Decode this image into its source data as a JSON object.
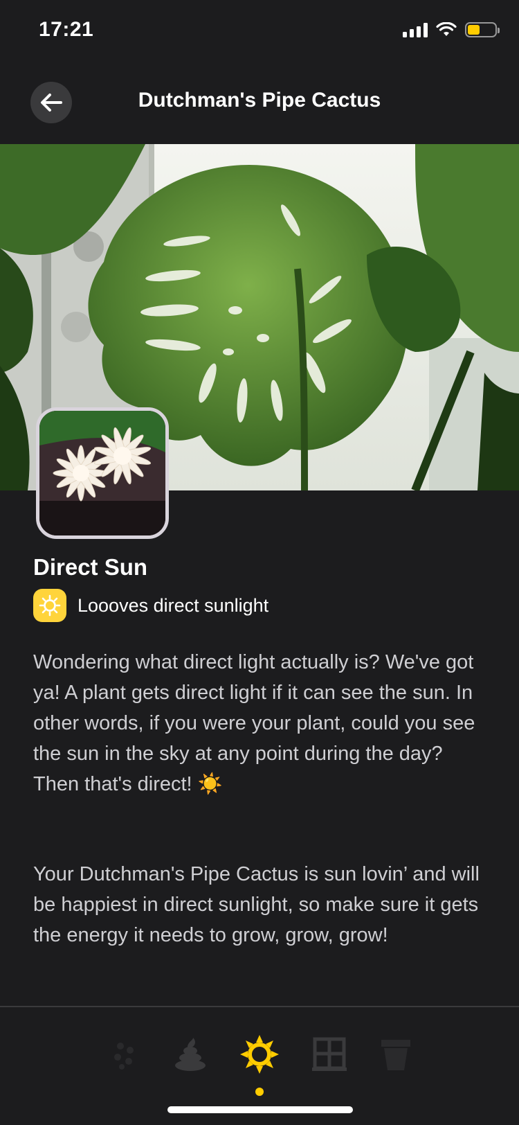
{
  "status_bar": {
    "time": "17:21",
    "signal_icon": "cellular-signal-icon",
    "wifi_icon": "wifi-icon",
    "battery_icon": "battery-icon",
    "battery_level": 0.45,
    "battery_color": "#ffcc00"
  },
  "header": {
    "back_icon": "arrow-left-icon",
    "title": "Dutchman's Pipe Cactus"
  },
  "hero": {
    "image": "monstera-leaf-photo",
    "thumbnail": "white-cactus-flower-photo"
  },
  "light": {
    "title": "Direct Sun",
    "badge_icon": "sun-icon",
    "badge_text": "Loooves direct sunlight",
    "accent_color": "#ffd43b"
  },
  "description": {
    "paragraph_1": "Wondering what direct light actually is? We've got ya! A plant gets direct light if it can see the sun. In other words, if you were your plant, could you see the sun in the sky at any point during the day? Then that's direct! ☀️",
    "paragraph_2": "Your Dutchman's Pipe Cactus is sun lovin’ and will be happiest in direct sunlight, so make sure it gets the energy it needs to grow, grow, grow!"
  },
  "tab_bar": {
    "tabs": [
      {
        "icon": "seeds-icon",
        "active": false
      },
      {
        "icon": "fertilizer-icon",
        "active": false
      },
      {
        "icon": "sun-icon",
        "active": true
      },
      {
        "icon": "window-icon",
        "active": false
      },
      {
        "icon": "pot-icon",
        "active": false
      }
    ],
    "active_color": "#ffcc00"
  }
}
